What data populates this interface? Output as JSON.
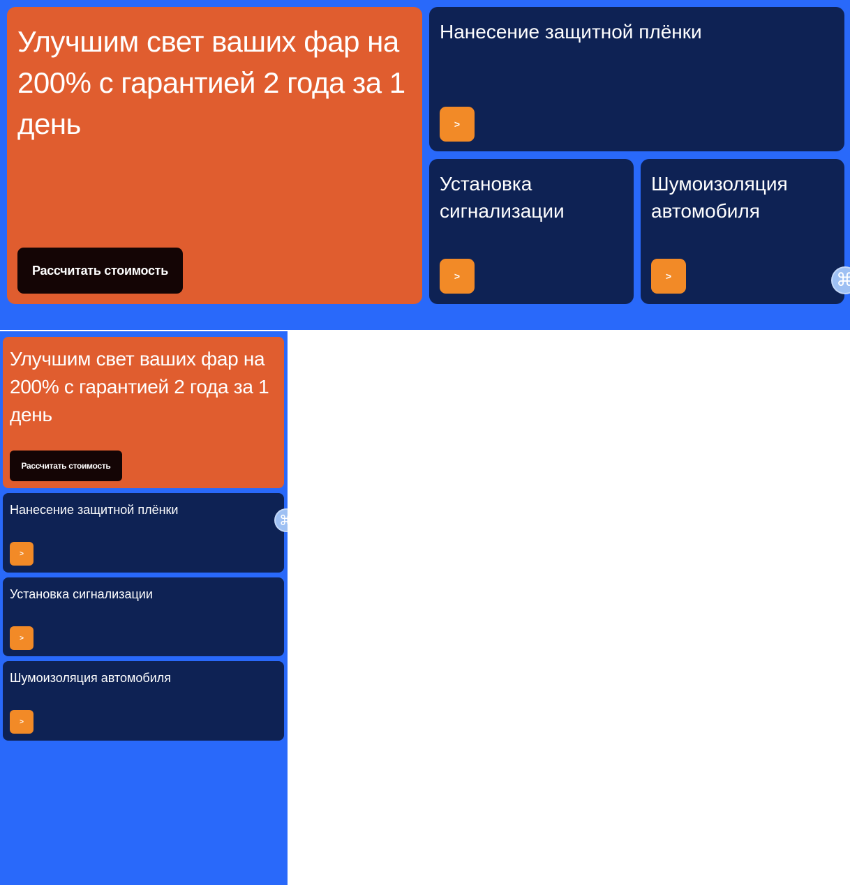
{
  "colors": {
    "page_bg": "#2969fa",
    "hero_bg": "#e05d2f",
    "card_bg": "#0e2254",
    "cta_bg": "#140505",
    "arrow_bg": "#f28a27",
    "text": "#ffffff"
  },
  "hero": {
    "title": "Улучшим свет ваших фар на 200% с гарантией 2 года за 1 день",
    "cta_label": "Рассчитать стоимость"
  },
  "services": [
    {
      "title": "Нанесение защитной плёнки",
      "arrow": ">"
    },
    {
      "title": "Установка сигнализации",
      "arrow": ">"
    },
    {
      "title": "Шумоизоляция автомобиля",
      "arrow": ">"
    }
  ],
  "widget": {
    "icon": "command-key-icon",
    "glyph": "⌘"
  }
}
